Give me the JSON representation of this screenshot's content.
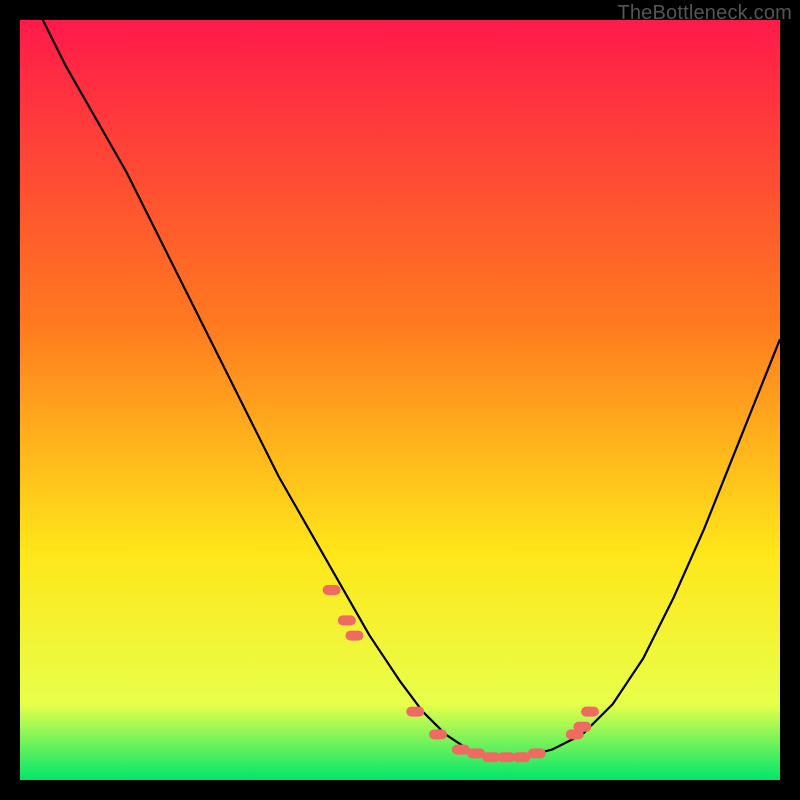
{
  "watermark": "TheBottleneck.com",
  "chart_data": {
    "type": "line",
    "title": "",
    "xlabel": "",
    "ylabel": "",
    "xlim": [
      0,
      100
    ],
    "ylim": [
      0,
      100
    ],
    "grid": false,
    "legend": false,
    "series": [
      {
        "name": "bottleneck-curve",
        "x": [
          3,
          6,
          10,
          14,
          18,
          22,
          26,
          30,
          34,
          38,
          42,
          46,
          50,
          53,
          56,
          59,
          62,
          66,
          70,
          74,
          78,
          82,
          86,
          90,
          94,
          98,
          100
        ],
        "y": [
          100,
          94,
          87,
          80,
          72,
          64,
          56,
          48,
          40,
          33,
          26,
          19,
          13,
          9,
          6,
          4,
          3,
          3,
          4,
          6,
          10,
          16,
          24,
          33,
          43,
          53,
          58
        ],
        "color": "#000000"
      }
    ],
    "markers": {
      "name": "data-points",
      "x": [
        41,
        43,
        44,
        52,
        55,
        58,
        60,
        62,
        64,
        66,
        68,
        73,
        74,
        75
      ],
      "y": [
        25,
        21,
        19,
        9,
        6,
        4,
        3.5,
        3,
        3,
        3,
        3.5,
        6,
        7,
        9
      ],
      "color": "#ef6b62"
    },
    "background_gradient": {
      "top": "#ff1a4a",
      "mid1": "#ff7a1f",
      "mid2": "#ffe61a",
      "low": "#e8ff4a",
      "bottom": "#00e66b"
    }
  }
}
